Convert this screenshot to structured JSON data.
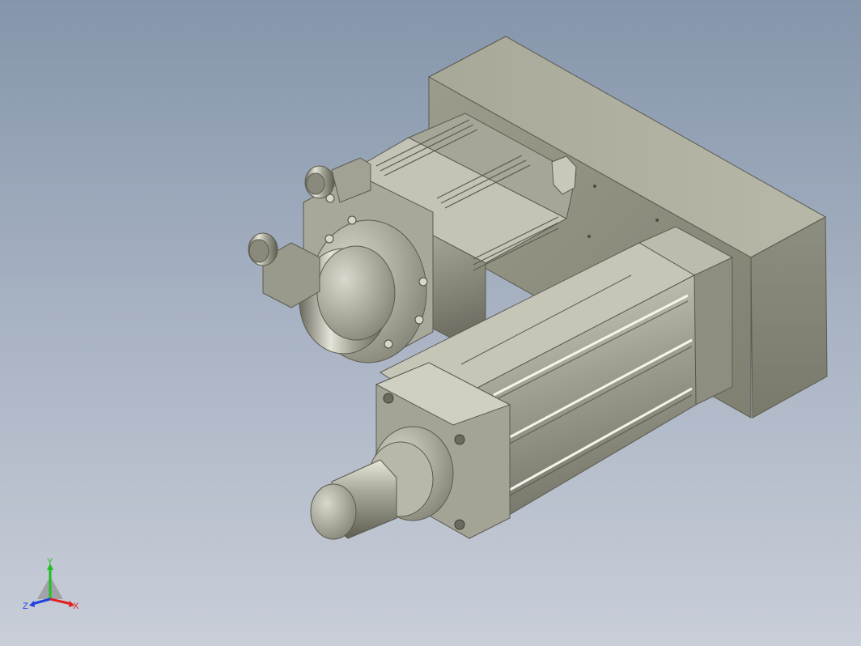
{
  "viewport": {
    "background_top": "#8595ab",
    "background_bottom": "#c9ced8"
  },
  "model": {
    "part_color": "#b4b4a4",
    "part_dark": "#6e6e60",
    "part_light": "#e8e8dc"
  },
  "triad": {
    "x_label": "X",
    "y_label": "Y",
    "z_label": "Z",
    "x_color": "#e02020",
    "y_color": "#20c020",
    "z_color": "#2040e0"
  }
}
